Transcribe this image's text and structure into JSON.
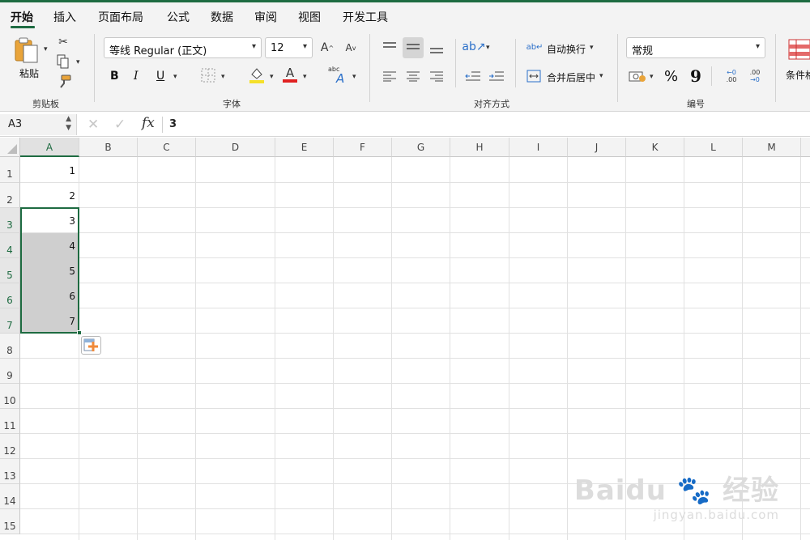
{
  "tabs": [
    {
      "label": "开始",
      "active": true
    },
    {
      "label": "插入"
    },
    {
      "label": "页面布局"
    },
    {
      "label": "公式"
    },
    {
      "label": "数据"
    },
    {
      "label": "审阅"
    },
    {
      "label": "视图"
    },
    {
      "label": "开发工具"
    }
  ],
  "ribbon": {
    "clipboard": {
      "paste_label": "粘贴",
      "group_label": "剪贴板"
    },
    "font": {
      "font_name": "等线 Regular (正文)",
      "font_size": "12",
      "group_label": "字体",
      "bold": "B",
      "italic": "I",
      "underline": "U",
      "font_color_glyph": "A",
      "increase_glyph": "A",
      "decrease_glyph": "A",
      "abc": "abc",
      "fill_color": "#f5e02a",
      "font_color": "#e02020"
    },
    "alignment": {
      "wrap_label": "自动换行",
      "merge_label": "合并后居中",
      "group_label": "对齐方式"
    },
    "number": {
      "format": "常规",
      "group_label": "编号",
      "percent": "%",
      "comma": "9"
    },
    "styles": {
      "conditional_label": "条件格"
    }
  },
  "formula_bar": {
    "name_box": "A3",
    "fx": "fx",
    "value": "3"
  },
  "grid": {
    "columns": [
      "A",
      "B",
      "C",
      "D",
      "E",
      "F",
      "G",
      "H",
      "I",
      "J",
      "K",
      "L",
      "M"
    ],
    "selected_column": "A",
    "rows": [
      "1",
      "2",
      "3",
      "4",
      "5",
      "6",
      "7",
      "8",
      "9",
      "10",
      "11",
      "12",
      "13",
      "14",
      "15"
    ],
    "selected_rows": [
      "3",
      "4",
      "5",
      "6",
      "7"
    ],
    "cells_A": [
      "1",
      "2",
      "3",
      "4",
      "5",
      "6",
      "7"
    ],
    "selection": "A3:A7",
    "accent": "#1e6b41"
  },
  "watermark": {
    "brand": "Baidu",
    "brand_cn": "经验",
    "url": "jingyan.baidu.com"
  }
}
